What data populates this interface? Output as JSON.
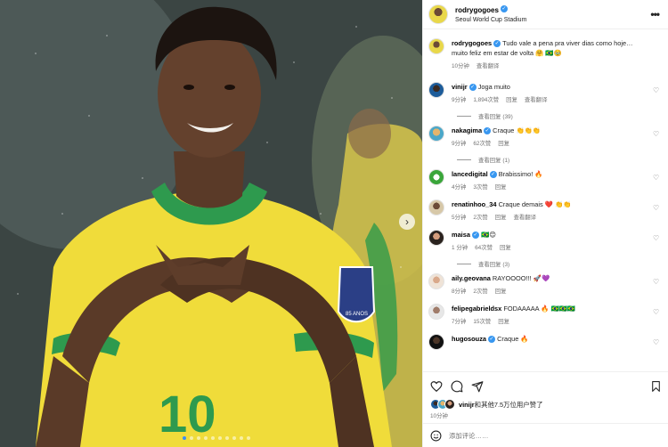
{
  "colors": {
    "verified": "#3897f0",
    "link": "#00376b",
    "muted": "#737373",
    "active_dot": "#3a8ef6"
  },
  "photo": {
    "jersey_number": "10",
    "badge_text": "85 ANOS",
    "carousel_dots": 10,
    "active_dot": 0,
    "next_icon": "chevron-right-icon"
  },
  "header": {
    "username": "rodrygogoes",
    "verified_mark": "✓",
    "location": "Seoul World Cup Stadium",
    "more_icon": "•••"
  },
  "caption": {
    "username": "rodrygogoes",
    "text": "Tudo vale a pena pra viver dias como hoje… muito feliz em estar de volta 🤗 🇧🇷🥹",
    "time": "10分钟",
    "translate": "查看翻译"
  },
  "comments": [
    {
      "username": "vinijr",
      "text": "Joga muito",
      "time": "9分钟",
      "likes": "1,894次赞",
      "reply": "回复",
      "translate": "查看翻译",
      "view_replies": "查看回复 (39)"
    },
    {
      "username": "nakagima",
      "text": "Craque 👏👏👏",
      "time": "9分钟",
      "likes": "62次赞",
      "reply": "回复",
      "translate": "",
      "view_replies": "查看回复 (1)"
    },
    {
      "username": "lancedigital",
      "text": "Brabissimo! 🔥",
      "time": "4分钟",
      "likes": "3次赞",
      "reply": "回复",
      "translate": "",
      "view_replies": ""
    },
    {
      "username": "renatinhoo_34",
      "text": "Craque demais ❤️ 👏👏",
      "time": "5分钟",
      "likes": "2次赞",
      "reply": "回复",
      "translate": "查看翻译",
      "view_replies": ""
    },
    {
      "username": "maisa",
      "text": "🇧🇷😊",
      "time": "1 分钟",
      "likes": "64次赞",
      "reply": "回复",
      "translate": "",
      "view_replies": "查看回复 (3)"
    },
    {
      "username": "aily.geovana",
      "text": "RAYOOOO!!! 🚀💜",
      "time": "8分钟",
      "likes": "2次赞",
      "reply": "回复",
      "translate": "",
      "view_replies": ""
    },
    {
      "username": "felipegabrieldsx",
      "text": "FODAAAAA 🔥 🇧🇷🇧🇷🇧🇷",
      "time": "7分钟",
      "likes": "15次赞",
      "reply": "回复",
      "translate": "",
      "view_replies": ""
    },
    {
      "username": "hugosouza",
      "text": "Craque 🔥",
      "time": "",
      "likes": "",
      "reply": "",
      "translate": "",
      "view_replies": ""
    }
  ],
  "actions": {
    "like_icon": "heart-icon",
    "comment_icon": "comment-icon",
    "share_icon": "share-icon",
    "save_icon": "bookmark-icon",
    "liked_by_user": "vinijr",
    "liked_by_rest": "和其他7.5万位用户赞了",
    "time": "10分钟"
  },
  "add_comment": {
    "placeholder": "添加评论……",
    "emoji_icon": "smiley-icon"
  }
}
